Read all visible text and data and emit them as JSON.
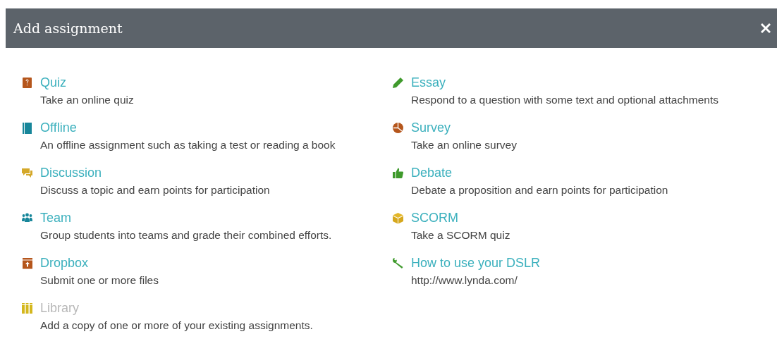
{
  "dialog": {
    "title": "Add assignment"
  },
  "columns": [
    {
      "items": [
        {
          "kind": "quiz",
          "title": "Quiz",
          "description": "Take an online quiz",
          "disabled": false
        },
        {
          "kind": "offline",
          "title": "Offline",
          "description": "An offline assignment such as taking a test or reading a book",
          "disabled": false
        },
        {
          "kind": "discussion",
          "title": "Discussion",
          "description": "Discuss a topic and earn points for participation",
          "disabled": false
        },
        {
          "kind": "team",
          "title": "Team",
          "description": "Group students into teams and grade their combined efforts.",
          "disabled": false
        },
        {
          "kind": "dropbox",
          "title": "Dropbox",
          "description": "Submit one or more files",
          "disabled": false
        },
        {
          "kind": "library",
          "title": "Library",
          "description": "Add a copy of one or more of your existing assignments.",
          "disabled": true
        }
      ]
    },
    {
      "items": [
        {
          "kind": "essay",
          "title": "Essay",
          "description": "Respond to a question with some text and optional attachments",
          "disabled": false
        },
        {
          "kind": "survey",
          "title": "Survey",
          "description": "Take an online survey",
          "disabled": false
        },
        {
          "kind": "debate",
          "title": "Debate",
          "description": "Debate a proposition and earn points for participation",
          "disabled": false
        },
        {
          "kind": "scorm",
          "title": "SCORM",
          "description": "Take a SCORM quiz",
          "disabled": false
        },
        {
          "kind": "external",
          "title": "How to use your DSLR",
          "description": "http://www.lynda.com/",
          "disabled": false
        }
      ]
    }
  ]
}
